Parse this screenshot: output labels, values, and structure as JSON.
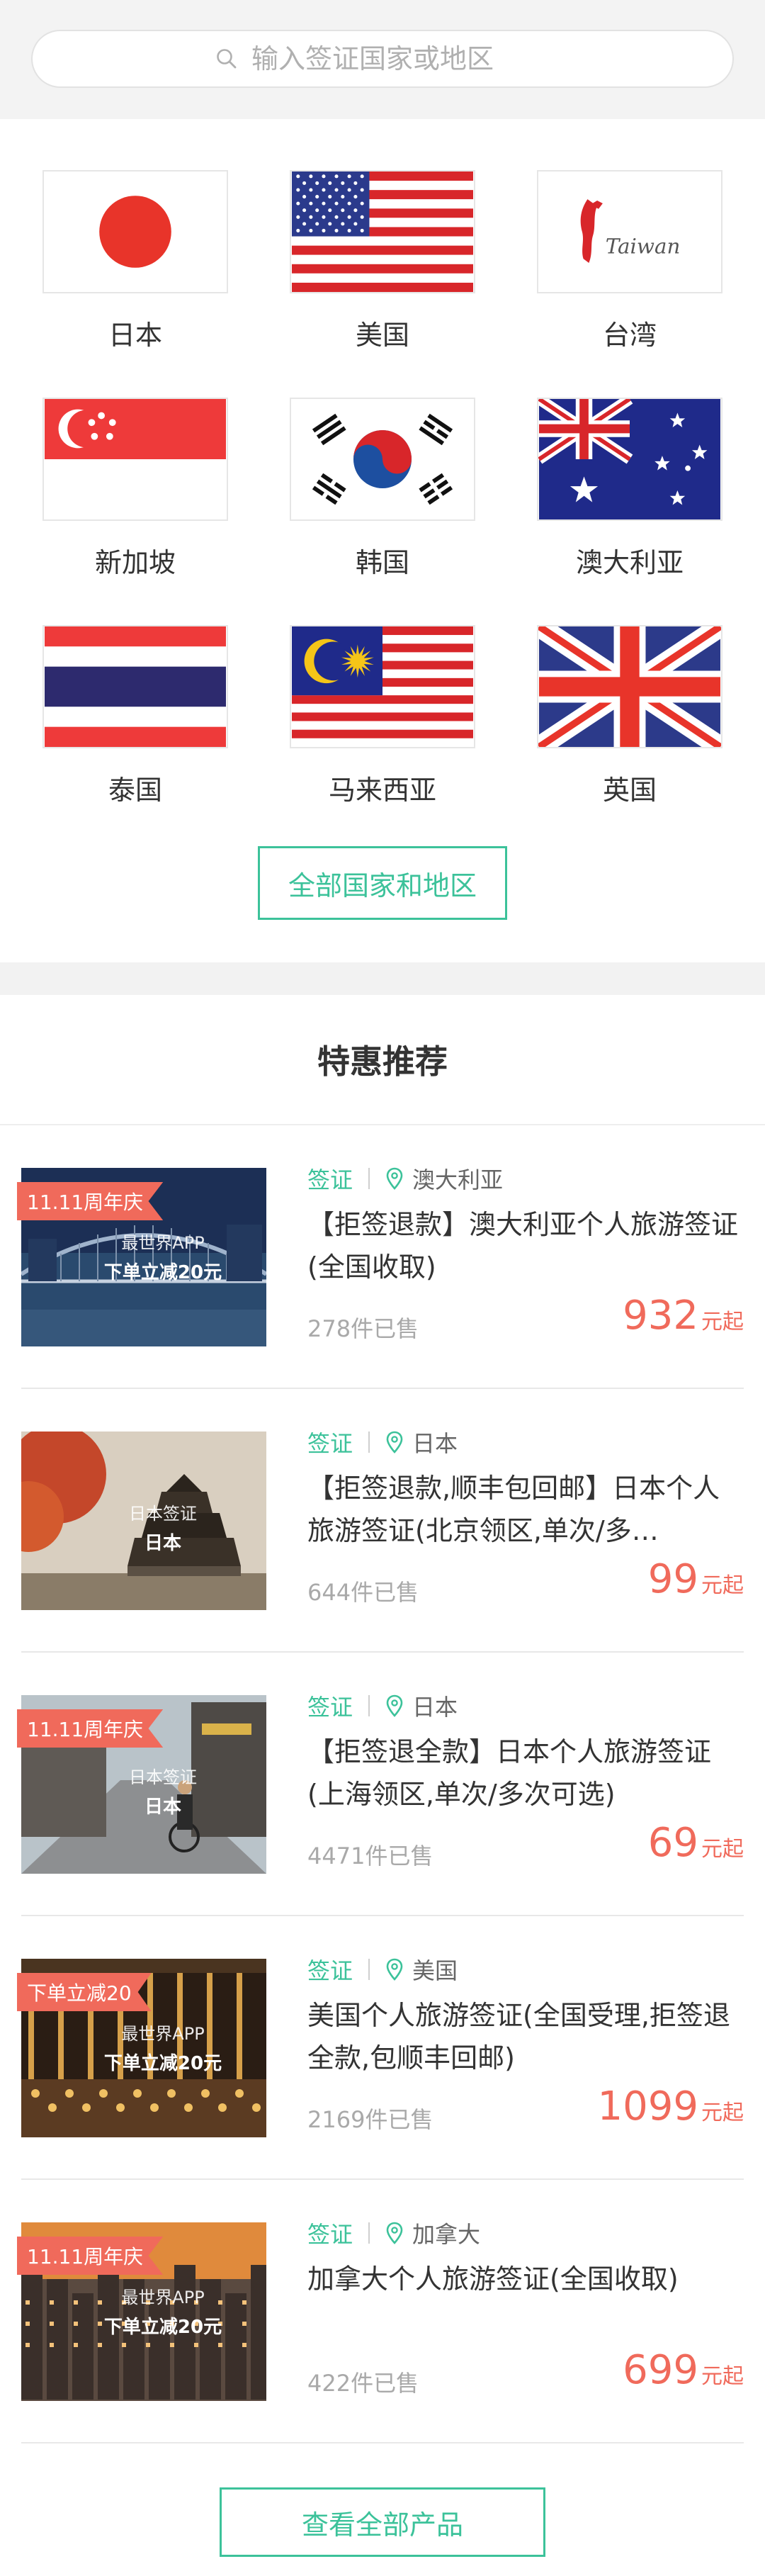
{
  "search": {
    "placeholder": "输入签证国家或地区",
    "icon": "search-icon"
  },
  "countries": [
    {
      "name": "日本",
      "flag": "japan-flag"
    },
    {
      "name": "美国",
      "flag": "usa-flag"
    },
    {
      "name": "台湾",
      "flag": "taiwan-flag"
    },
    {
      "name": "新加坡",
      "flag": "singapore-flag"
    },
    {
      "name": "韩国",
      "flag": "korea-flag"
    },
    {
      "name": "澳大利亚",
      "flag": "australia-flag"
    },
    {
      "name": "泰国",
      "flag": "thailand-flag"
    },
    {
      "name": "马来西亚",
      "flag": "malaysia-flag"
    },
    {
      "name": "英国",
      "flag": "uk-flag"
    }
  ],
  "taiwan_flag_text": "Taiwan",
  "all_countries_label": "全部国家和地区",
  "deals_title": "特惠推荐",
  "deals": [
    {
      "ribbon": "11.11周年庆",
      "caption1": "最世界APP",
      "caption2": "下单立减20元",
      "category": "签证",
      "location": "澳大利亚",
      "title": "【拒签退款】澳大利亚个人旅游签证(全国收取)",
      "sold": "278件已售",
      "price": "932",
      "unit": "元起"
    },
    {
      "ribbon": "",
      "caption1": "日本签证",
      "caption2": "日本",
      "category": "签证",
      "location": "日本",
      "title": "【拒签退款,顺丰包回邮】日本个人旅游签证(北京领区,单次/多…",
      "sold": "644件已售",
      "price": "99",
      "unit": "元起"
    },
    {
      "ribbon": "11.11周年庆",
      "caption1": "日本签证",
      "caption2": "日本",
      "category": "签证",
      "location": "日本",
      "title": "【拒签退全款】日本个人旅游签证(上海领区,单次/多次可选)",
      "sold": "4471件已售",
      "price": "69",
      "unit": "元起"
    },
    {
      "ribbon": "下单立减20",
      "caption1": "最世界APP",
      "caption2": "下单立减20元",
      "category": "签证",
      "location": "美国",
      "title": "美国个人旅游签证(全国受理,拒签退全款,包顺丰回邮)",
      "sold": "2169件已售",
      "price": "1099",
      "unit": "元起"
    },
    {
      "ribbon": "11.11周年庆",
      "caption1": "最世界APP",
      "caption2": "下单立减20元",
      "category": "签证",
      "location": "加拿大",
      "title": "加拿大个人旅游签证(全国收取)",
      "sold": "422件已售",
      "price": "699",
      "unit": "元起"
    }
  ],
  "view_all_label": "查看全部产品",
  "colors": {
    "accent": "#3cc29a",
    "price": "#f06a5b",
    "ribbon": "#f06a5b"
  }
}
